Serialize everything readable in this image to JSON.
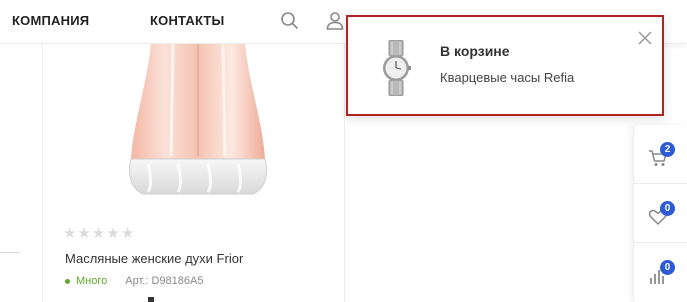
{
  "header": {
    "nav": [
      {
        "label": "КОМПАНИЯ"
      },
      {
        "label": "КОНТАКТЫ"
      }
    ],
    "icons": [
      "search-icon",
      "user-icon"
    ]
  },
  "product": {
    "title": "Масляные женские духи Frior",
    "rating": 0,
    "rating_max": 5,
    "stock": "Много",
    "sku": "Арт.: D98186A5"
  },
  "popup": {
    "title": "В корзине",
    "text": "Кварцевые часы Refia"
  },
  "side_panel": {
    "cart_count": "2",
    "favorites_count": "0",
    "compare_count": "0"
  },
  "colors": {
    "popup_border": "#b32121",
    "badge": "#2d5bd6",
    "stock": "#5fa72a"
  }
}
